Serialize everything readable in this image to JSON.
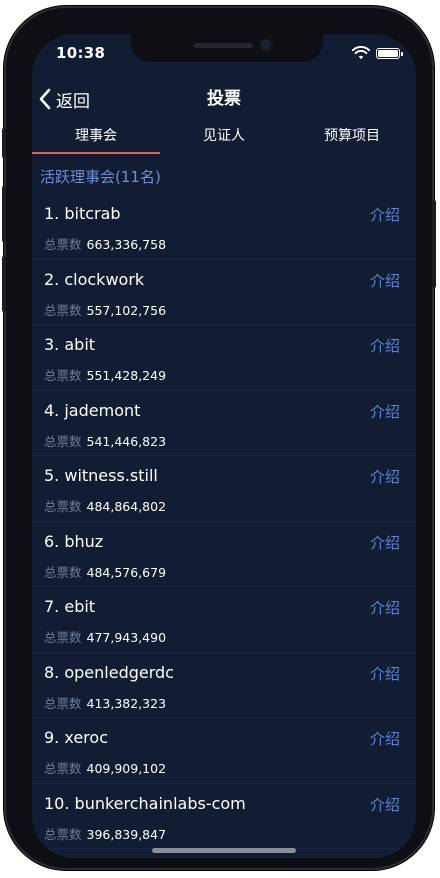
{
  "status_bar": {
    "time": "10:38"
  },
  "navbar": {
    "back_label": "返回",
    "title": "投票"
  },
  "tabs": [
    {
      "label": "理事会",
      "active": true
    },
    {
      "label": "见证人",
      "active": false
    },
    {
      "label": "预算项目",
      "active": false
    }
  ],
  "section": {
    "header": "活跃理事会(11名)"
  },
  "votes_label": "总票数",
  "intro_label": "介绍",
  "members": [
    {
      "name": "1. bitcrab",
      "votes": "663,336,758"
    },
    {
      "name": "2. clockwork",
      "votes": "557,102,756"
    },
    {
      "name": "3. abit",
      "votes": "551,428,249"
    },
    {
      "name": "4. jademont",
      "votes": "541,446,823"
    },
    {
      "name": "5. witness.still",
      "votes": "484,864,802"
    },
    {
      "name": "6. bhuz",
      "votes": "484,576,679"
    },
    {
      "name": "7. ebit",
      "votes": "477,943,490"
    },
    {
      "name": "8. openledgerdc",
      "votes": "413,382,323"
    },
    {
      "name": "9. xeroc",
      "votes": "409,909,102"
    },
    {
      "name": "10. bunkerchainlabs-com",
      "votes": "396,839,847"
    }
  ],
  "colors": {
    "background": "#121d33",
    "accent": "#5b86d6",
    "tab_indicator": "#d9674e",
    "section_header": "#6d8fd6"
  }
}
